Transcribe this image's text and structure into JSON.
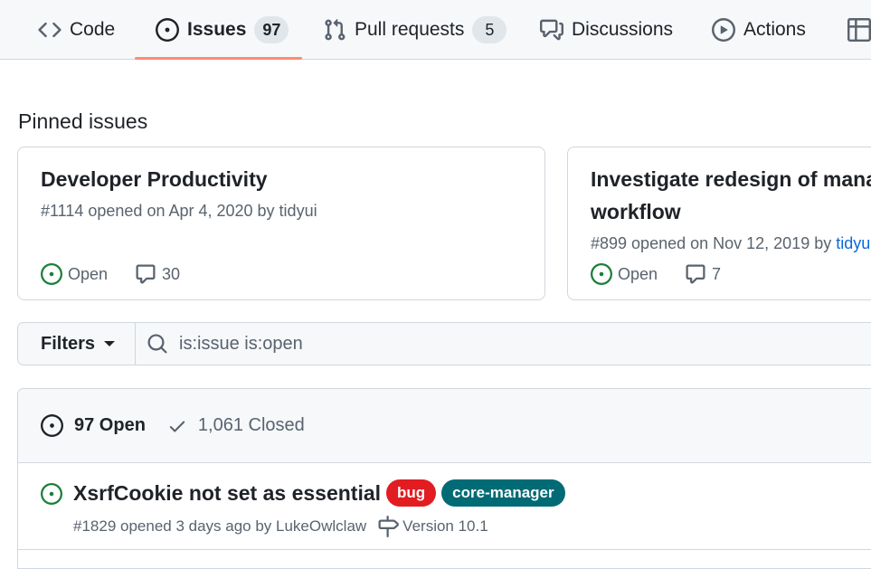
{
  "nav": {
    "tabs": [
      {
        "label": "Code",
        "icon": "code-icon"
      },
      {
        "label": "Issues",
        "count": "97",
        "icon": "issue-opened-icon",
        "selected": true
      },
      {
        "label": "Pull requests",
        "count": "5",
        "icon": "git-pull-request-icon"
      },
      {
        "label": "Discussions",
        "icon": "comment-discussion-icon"
      },
      {
        "label": "Actions",
        "icon": "play-icon"
      },
      {
        "label": "",
        "icon": "table-icon"
      }
    ],
    "underline_color": "#fd8c73"
  },
  "pinned": {
    "heading": "Pinned issues",
    "cards": [
      {
        "title": "Developer Productivity",
        "meta": "#1114 opened on Apr 4, 2020 by tidyui",
        "state": "Open",
        "comments": "30"
      },
      {
        "title": "Investigate redesign of mana workflow",
        "meta_prefix": "#899 opened on Nov 12, 2019 by ",
        "meta_author": "tidyui",
        "state": "Open",
        "comments": "7"
      }
    ]
  },
  "filter": {
    "button_label": "Filters",
    "search_value": "is:issue is:open"
  },
  "issues": {
    "open_label": "97 Open",
    "closed_label": "1,061 Closed",
    "rows": [
      {
        "title": "XsrfCookie not set as essential",
        "labels": [
          {
            "name": "bug",
            "color": "#e11d21"
          },
          {
            "name": "core-manager",
            "color": "#006b75"
          }
        ],
        "meta": "#1829 opened 3 days ago by LukeOwlclaw",
        "milestone": "Version 10.1"
      }
    ]
  },
  "colors": {
    "open_green": "#1a7f37",
    "muted_text": "#59636e",
    "border": "#d0d7de",
    "header_bg": "#f6f8fa"
  }
}
